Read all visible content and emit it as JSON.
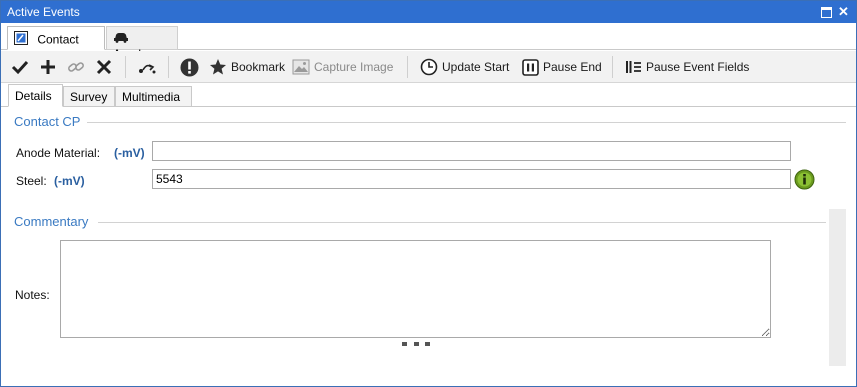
{
  "window": {
    "title": "Active Events"
  },
  "doc_tabs": [
    {
      "label": "Contact CP",
      "icon": "contact-cp-icon",
      "active": true
    },
    {
      "label": "Anode",
      "icon": "vehicle-icon",
      "active": false
    }
  ],
  "toolbar": {
    "accept_icon": "check-icon",
    "add_icon": "plus-icon",
    "link_icon": "link-icon",
    "delete_icon": "x-icon",
    "route_icon": "route-icon",
    "alert_icon": "exclamation-icon",
    "bookmark_label": "Bookmark",
    "capture_image_label": "Capture Image",
    "update_start_label": "Update Start",
    "pause_end_label": "Pause End",
    "pause_event_fields_label": "Pause Event Fields"
  },
  "sub_tabs": [
    {
      "label": "Details",
      "active": true
    },
    {
      "label": "Survey",
      "active": false
    },
    {
      "label": "Multimedia",
      "active": false
    }
  ],
  "contact_cp": {
    "section_title": "Contact CP",
    "anode_material": {
      "label": "Anode Material:",
      "unit": "(-mV)",
      "value": ""
    },
    "steel": {
      "label": "Steel:",
      "unit": "(-mV)",
      "value": "5543"
    }
  },
  "commentary": {
    "section_title": "Commentary",
    "notes_label": "Notes:",
    "notes_value": ""
  },
  "colors": {
    "title_bar": "#2f6fd0",
    "section_title": "#3a7ac2",
    "unit_text": "#2a5fa0",
    "info_icon": "#6a9a1e"
  }
}
